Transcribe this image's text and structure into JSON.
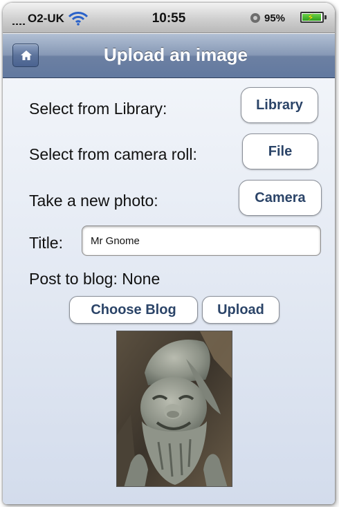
{
  "status_bar": {
    "carrier": "O2-UK",
    "time": "10:55",
    "battery_percent_label": "95%",
    "battery_level": 0.95,
    "icons": [
      "signal-icon",
      "wifi-icon",
      "rotation-lock-icon",
      "battery-charging-icon"
    ]
  },
  "nav": {
    "home_icon": "home-icon",
    "title": "Upload an image",
    "bar_color": "#6c80a2"
  },
  "form": {
    "library_label": "Select from Library:",
    "library_button": "Library",
    "camera_roll_label": "Select from camera roll:",
    "file_button": "File",
    "new_photo_label": "Take a new photo:",
    "camera_button": "Camera",
    "title_label": "Title:",
    "title_value": "Mr Gnome",
    "post_to_blog_label": "Post to blog:",
    "post_to_blog_value": "None",
    "choose_blog_button": "Choose Blog",
    "upload_button": "Upload",
    "button_text_color": "#2b4468"
  },
  "preview": {
    "subject": "garden gnome statue photo"
  }
}
